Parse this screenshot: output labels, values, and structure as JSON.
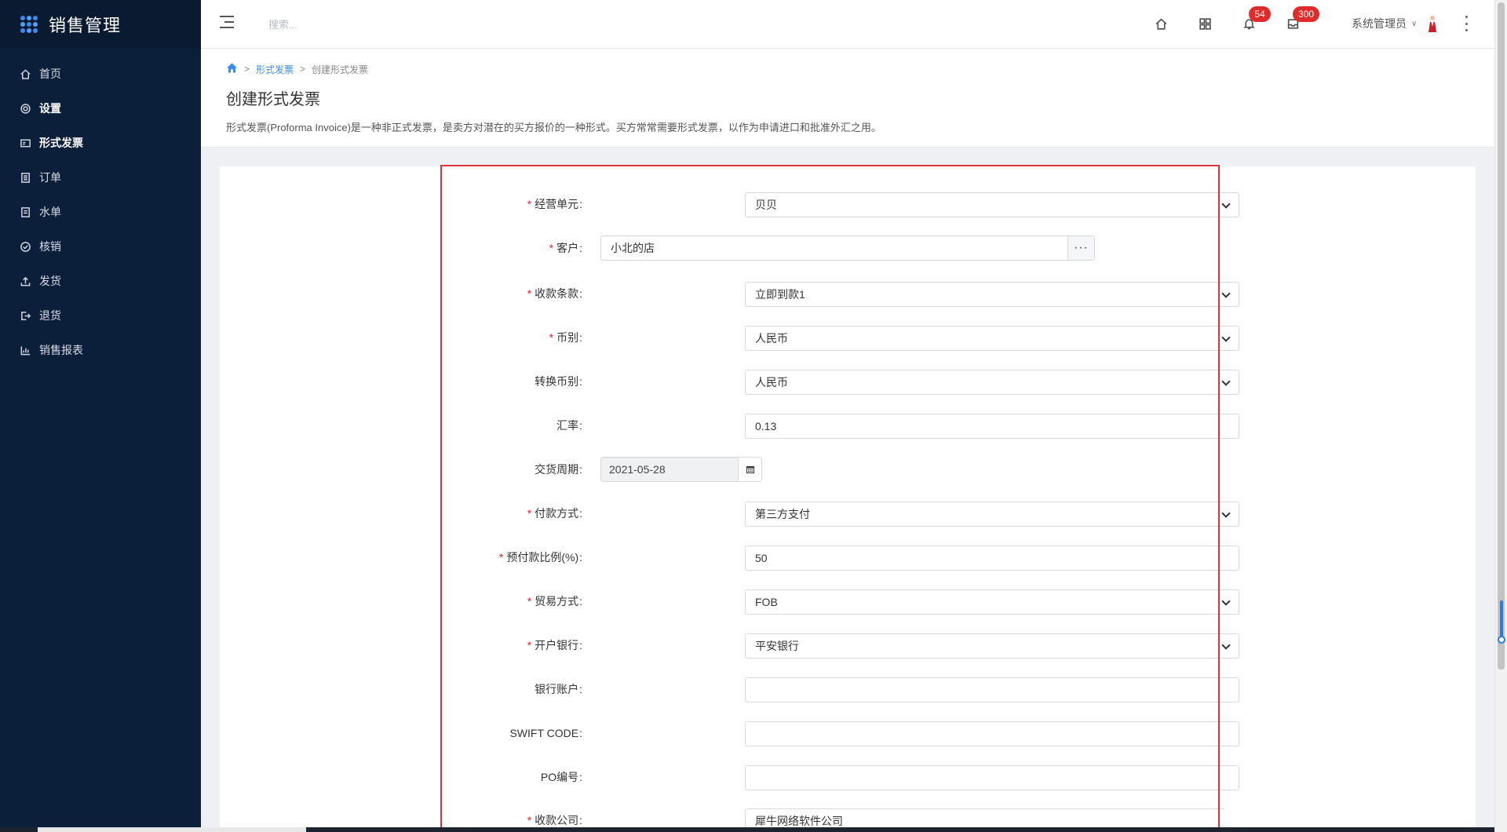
{
  "app": {
    "title": "销售管理"
  },
  "sidebar": {
    "items": [
      {
        "label": "首页",
        "icon": "home-icon"
      },
      {
        "label": "设置",
        "icon": "gear-icon"
      },
      {
        "label": "形式发票",
        "icon": "invoice-icon"
      },
      {
        "label": "订单",
        "icon": "order-icon"
      },
      {
        "label": "水单",
        "icon": "receipt-icon"
      },
      {
        "label": "核销",
        "icon": "check-circle-icon"
      },
      {
        "label": "发货",
        "icon": "upload-icon"
      },
      {
        "label": "退货",
        "icon": "logout-icon"
      },
      {
        "label": "销售报表",
        "icon": "bar-chart-icon"
      }
    ],
    "active": "形式发票"
  },
  "header": {
    "search_placeholder": "搜索...",
    "notifications_count": "54",
    "messages_count": "300",
    "user_name": "系统管理员"
  },
  "breadcrumb": {
    "parent": "形式发票",
    "current": "创建形式发票"
  },
  "page": {
    "title": "创建形式发票",
    "description": "形式发票(Proforma Invoice)是一种非正式发票，是卖方对潜在的买方报价的一种形式。买方常常需要形式发票，以作为申请进口和批准外汇之用。"
  },
  "form": {
    "business_unit": {
      "label": "经营单元",
      "value": "贝贝"
    },
    "customer": {
      "label": "客户",
      "value": "小北的店"
    },
    "payment_terms": {
      "label": "收款条款",
      "value": "立即到款1"
    },
    "currency": {
      "label": "币别",
      "value": "人民币"
    },
    "convert_currency": {
      "label": "转换币别",
      "value": "人民币"
    },
    "exchange_rate": {
      "label": "汇率",
      "value": "0.13"
    },
    "delivery_date": {
      "label": "交货周期",
      "value": "2021-05-28"
    },
    "payment_method": {
      "label": "付款方式",
      "value": "第三方支付"
    },
    "prepay_ratio": {
      "label": "预付款比例(%)",
      "value": "50"
    },
    "trade_mode": {
      "label": "贸易方式",
      "value": "FOB"
    },
    "bank": {
      "label": "开户银行",
      "value": "平安银行"
    },
    "bank_account": {
      "label": "银行账户",
      "value": ""
    },
    "swift_code": {
      "label": "SWIFT CODE",
      "value": ""
    },
    "po_number": {
      "label": "PO编号",
      "value": ""
    },
    "payee_company": {
      "label": "收款公司",
      "value": "犀牛网络软件公司"
    }
  },
  "colors": {
    "sidebar_bg": "#0c1f3a",
    "accent": "#3b8cf0",
    "badge": "#e02b2b",
    "highlight_border": "#e0323c"
  }
}
